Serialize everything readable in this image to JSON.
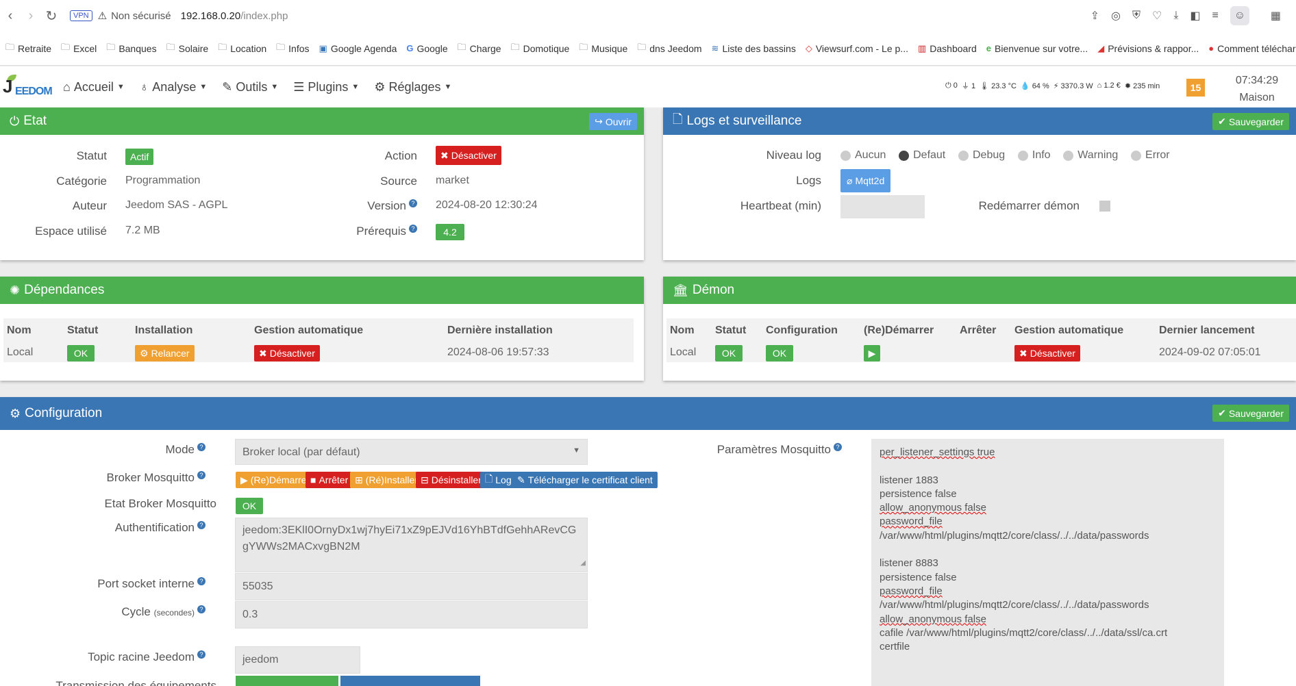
{
  "browser": {
    "vpn": "VPN",
    "insecure": "Non sécurisé",
    "url_host": "192.168.0.20",
    "url_path": "/index.php"
  },
  "bookmarks": [
    "Retraite",
    "Excel",
    "Banques",
    "Solaire",
    "Location",
    "Infos",
    "Google Agenda",
    "Google",
    "Charge",
    "Domotique",
    "Musique",
    "dns Jeedom",
    "Liste des bassins",
    "Viewsurf.com - Le p...",
    "Dashboard",
    "Bienvenue sur votre...",
    "Prévisions & rappor...",
    "Comment télécharg..."
  ],
  "nav": {
    "logo": "EEDOM",
    "menu": [
      "Accueil",
      "Analyse",
      "Outils",
      "Plugins",
      "Réglages"
    ],
    "widgets": [
      "0",
      "1",
      "23.3 °C",
      "64 %",
      "3370.3 W",
      "1.2 €",
      "235 min"
    ],
    "badge": "15",
    "time": "07:34:29",
    "place": "Maison"
  },
  "etat": {
    "title": "Etat",
    "open_btn": "Ouvrir",
    "statut_label": "Statut",
    "statut": "Actif",
    "categorie_label": "Catégorie",
    "categorie": "Programmation",
    "auteur_label": "Auteur",
    "auteur": "Jeedom SAS - AGPL",
    "espace_label": "Espace utilisé",
    "espace": "7.2 MB",
    "action_label": "Action",
    "action_btn": "Désactiver",
    "source_label": "Source",
    "source": "market",
    "version_label": "Version",
    "version": "2024-08-20 12:30:24",
    "prerequis_label": "Prérequis",
    "prerequis": "4.2"
  },
  "logs": {
    "title": "Logs et surveillance",
    "save_btn": "Sauvegarder",
    "niveau_label": "Niveau log",
    "levels": [
      "Aucun",
      "Defaut",
      "Debug",
      "Info",
      "Warning",
      "Error"
    ],
    "logs_label": "Logs",
    "logs_btn": "Mqtt2d",
    "heartbeat_label": "Heartbeat (min)",
    "restart_label": "Redémarrer démon"
  },
  "deps": {
    "title": "Dépendances",
    "headers": [
      "Nom",
      "Statut",
      "Installation",
      "Gestion automatique",
      "Dernière installation"
    ],
    "nom": "Local",
    "statut": "OK",
    "install_btn": "Relancer",
    "gestion_btn": "Désactiver",
    "last": "2024-08-06 19:57:33"
  },
  "demon": {
    "title": "Démon",
    "headers": [
      "Nom",
      "Statut",
      "Configuration",
      "(Re)Démarrer",
      "Arrêter",
      "Gestion automatique",
      "Dernier lancement"
    ],
    "nom": "Local",
    "statut": "OK",
    "config": "OK",
    "gestion_btn": "Désactiver",
    "last": "2024-09-02 07:05:01"
  },
  "config": {
    "title": "Configuration",
    "save_btn": "Sauvegarder",
    "mode_label": "Mode",
    "mode_value": "Broker local (par défaut)",
    "broker_label": "Broker Mosquitto",
    "broker_btns": [
      "(Re)Démarrer",
      "Arrêter",
      "(Ré)Installer",
      "Désinstaller",
      "Log",
      "Télécharger le certificat client"
    ],
    "etat_label": "Etat Broker Mosquitto",
    "etat": "OK",
    "auth_label": "Authentification",
    "auth_value": "jeedom:3EKlI0OrnyDx1wj7hyEi71xZ9pEJVd16YhBTdfGehhARevCGgYWWs2MACxvgBN2M",
    "port_label": "Port socket interne",
    "port_value": "55035",
    "cycle_label": "Cycle",
    "cycle_unit": "(secondes)",
    "cycle_value": "0.3",
    "topic_label": "Topic racine Jeedom",
    "topic_value": "jeedom",
    "transmission_label": "Transmission des équipements",
    "params_label": "Paramètres Mosquitto",
    "params_lines": [
      "per_listener_settings true",
      "",
      "listener 1883",
      "persistence false",
      "allow_anonymous false",
      "password_file",
      "/var/www/html/plugins/mqtt2/core/class/../../data/passwords",
      "",
      "listener 8883",
      "persistence false",
      "password_file",
      "/var/www/html/plugins/mqtt2/core/class/../../data/passwords",
      "allow_anonymous false",
      "cafile /var/www/html/plugins/mqtt2/core/class/../../data/ssl/ca.crt",
      "certfile"
    ]
  }
}
